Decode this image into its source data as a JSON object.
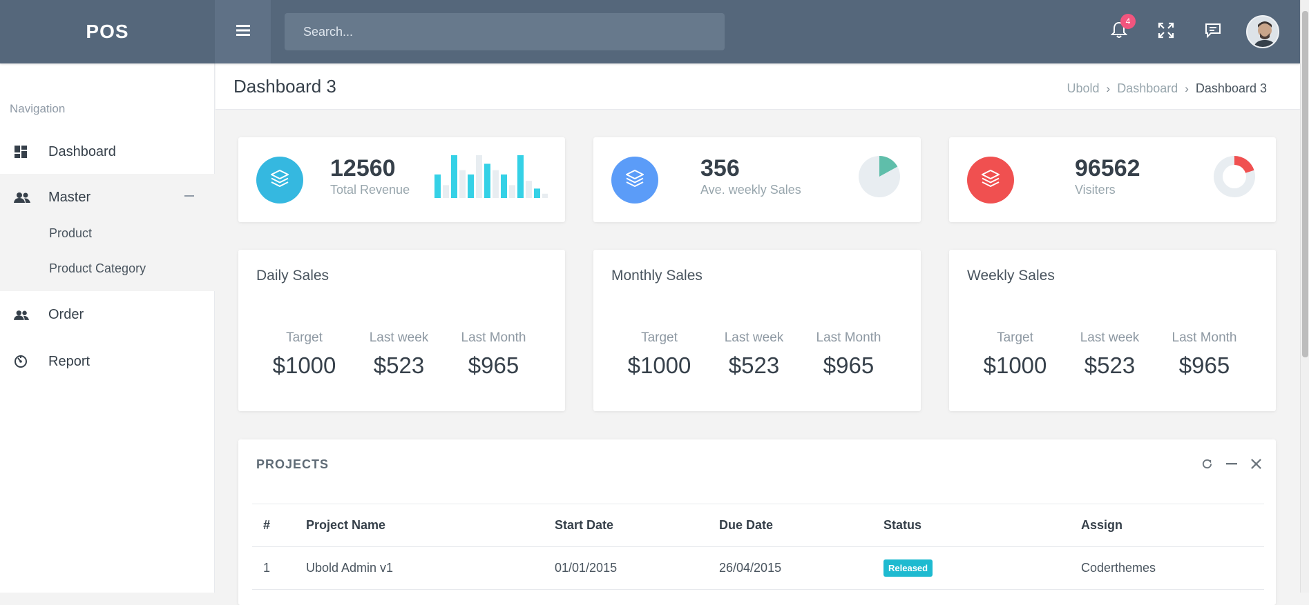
{
  "topbar": {
    "logo": "POS",
    "search_placeholder": "Search...",
    "notification_count": "4",
    "icons": [
      "menu-icon",
      "bell-icon",
      "fullscreen-icon",
      "chat-icon"
    ]
  },
  "sidebar": {
    "title": "Navigation",
    "items": [
      {
        "label": "Dashboard",
        "icon": "dashboard-icon"
      },
      {
        "label": "Master",
        "icon": "users-icon"
      },
      {
        "label": "Order",
        "icon": "users-icon"
      },
      {
        "label": "Report",
        "icon": "report-icon"
      }
    ],
    "subitems": [
      {
        "label": "Product"
      },
      {
        "label": "Product Category"
      }
    ]
  },
  "page": {
    "title": "Dashboard 3",
    "breadcrumb": [
      "Ubold",
      "Dashboard",
      "Dashboard 3"
    ]
  },
  "stats": [
    {
      "value": "12560",
      "label": "Total Revenue",
      "color": "#35b8e0",
      "icon": "layers-icon"
    },
    {
      "value": "356",
      "label": "Ave. weekly Sales",
      "color": "#5b9cf8",
      "icon": "layers-icon"
    },
    {
      "value": "96562",
      "label": "Visiters",
      "color": "#f05050",
      "icon": "layers-icon"
    }
  ],
  "sparkline": {
    "highlight": [
      0.55,
      1.0,
      0.55,
      0.8,
      0.55,
      1.0,
      0.22
    ],
    "background": [
      0.3,
      0.65,
      1.0,
      0.65,
      0.3,
      0.4,
      0.1
    ],
    "color": "#35d1e6",
    "bg_color": "#e8edf1"
  },
  "pie_fraction_weekly": 0.17,
  "donut_fraction_visiters": 0.2,
  "sales": [
    {
      "title": "Daily Sales",
      "metrics": [
        {
          "label": "Target",
          "value": "$1000"
        },
        {
          "label": "Last week",
          "value": "$523"
        },
        {
          "label": "Last Month",
          "value": "$965"
        }
      ]
    },
    {
      "title": "Monthly Sales",
      "metrics": [
        {
          "label": "Target",
          "value": "$1000"
        },
        {
          "label": "Last week",
          "value": "$523"
        },
        {
          "label": "Last Month",
          "value": "$965"
        }
      ]
    },
    {
      "title": "Weekly Sales",
      "metrics": [
        {
          "label": "Target",
          "value": "$1000"
        },
        {
          "label": "Last week",
          "value": "$523"
        },
        {
          "label": "Last Month",
          "value": "$965"
        }
      ]
    }
  ],
  "projects": {
    "title": "PROJECTS",
    "columns": [
      "#",
      "Project Name",
      "Start Date",
      "Due Date",
      "Status",
      "Assign"
    ],
    "rows": [
      {
        "num": "1",
        "name": "Ubold Admin v1",
        "start": "01/01/2015",
        "due": "26/04/2015",
        "status": "Released",
        "assign": "Coderthemes"
      }
    ]
  }
}
